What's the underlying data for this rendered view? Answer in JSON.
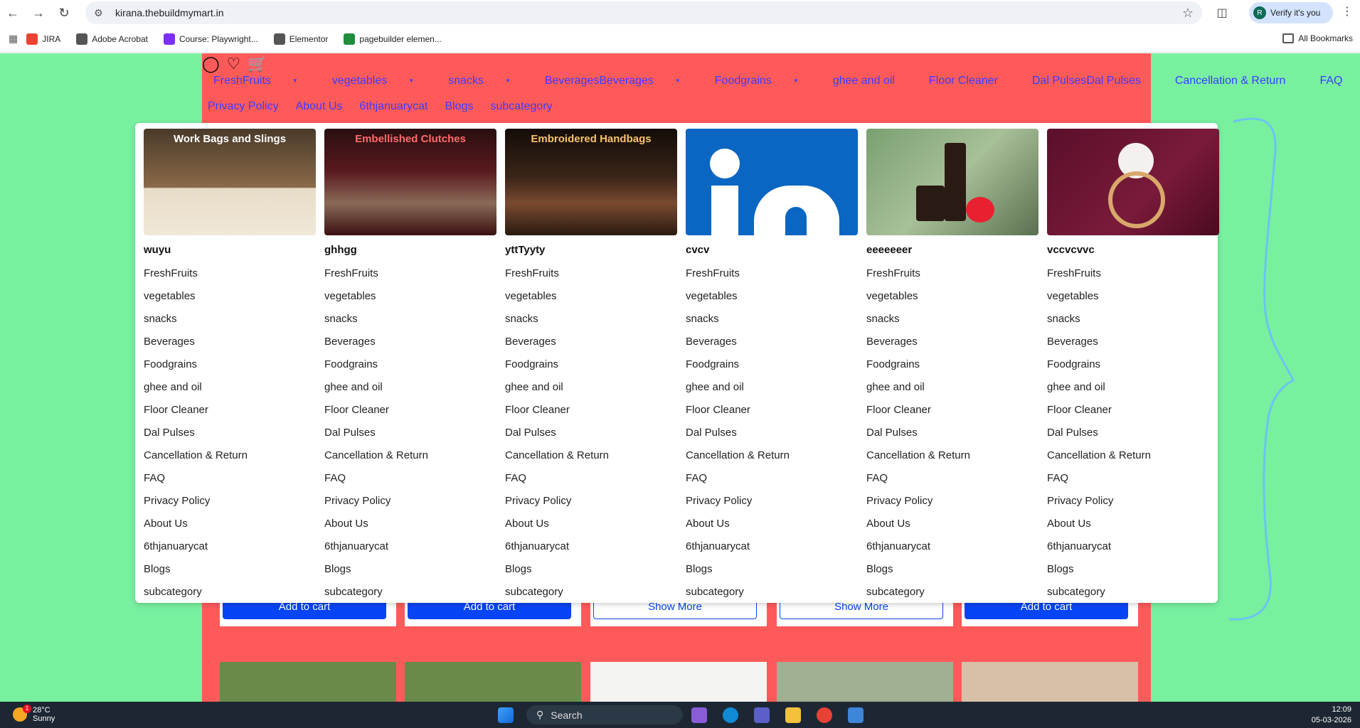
{
  "browser": {
    "url": "kirana.thebuildmymart.in",
    "verify_label": "Verify it's you",
    "profile_initial": "R",
    "bookmarks": [
      {
        "label": "JIRA",
        "color": "#ea4335"
      },
      {
        "label": "Adobe Acrobat",
        "color": "#555555"
      },
      {
        "label": "Course: Playwright...",
        "color": "#7b2ff7"
      },
      {
        "label": "Elementor",
        "color": "#555555"
      },
      {
        "label": "pagebuilder elemen...",
        "color": "#1e8e3e"
      }
    ],
    "all_bookmarks": "All Bookmarks"
  },
  "nav": {
    "row1": [
      {
        "label": "FreshFruits",
        "caret": true
      },
      {
        "label": "vegetables",
        "caret": true
      },
      {
        "label": "snacks",
        "caret": true
      },
      {
        "label": "BeveragesBeverages",
        "caret": true
      },
      {
        "label": "Foodgrains",
        "caret": true
      },
      {
        "label": "ghee and oil",
        "caret": false
      },
      {
        "label": "Floor Cleaner",
        "caret": false
      },
      {
        "label": "Dal PulsesDal Pulses",
        "caret": false
      },
      {
        "label": "Cancellation & Return",
        "caret": false
      },
      {
        "label": "FAQ",
        "caret": false
      }
    ],
    "row2": [
      "Privacy Policy",
      "About Us",
      "6thjanuarycat",
      "Blogs",
      "subcategory"
    ]
  },
  "mega_menu": {
    "columns": [
      {
        "title": "wuyu",
        "image_caption": "Work Bags and Slings",
        "caption_color": "#ffffff"
      },
      {
        "title": "ghhgg",
        "image_caption": "Embellished Clutches",
        "caption_color": "#ff6b6b"
      },
      {
        "title": "yttTyyty",
        "image_caption": "Embroidered Handbags",
        "caption_color": "#f6c26b"
      },
      {
        "title": "cvcv",
        "image_caption": "",
        "caption_color": "#ffffff"
      },
      {
        "title": "eeeeeeer",
        "image_caption": "",
        "caption_color": "#ffffff"
      },
      {
        "title": "vccvcvvc",
        "image_caption": "",
        "caption_color": "#ffffff"
      }
    ],
    "items": [
      "FreshFruits",
      "vegetables",
      "snacks",
      "Beverages",
      "Foodgrains",
      "ghee and oil",
      "Floor Cleaner",
      "Dal Pulses",
      "Cancellation & Return",
      "FAQ",
      "Privacy Policy",
      "About Us",
      "6thjanuarycat",
      "Blogs",
      "subcategory"
    ]
  },
  "product_buttons": [
    {
      "label": "Add to cart",
      "style": "fill"
    },
    {
      "label": "Add to cart",
      "style": "fill"
    },
    {
      "label": "Show More",
      "style": "outline"
    },
    {
      "label": "Show More",
      "style": "outline"
    },
    {
      "label": "Add to cart",
      "style": "fill"
    }
  ],
  "taskbar": {
    "temperature": "28°C",
    "weather": "Sunny",
    "notification_count": "1",
    "search_placeholder": "Search",
    "time": "12:09",
    "date": "05-03-2026"
  },
  "colors": {
    "page_bg": "#78f0a0",
    "panel_bg": "#ff5a5a",
    "nav_link": "#3b3bff",
    "button_blue": "#0645f5"
  }
}
